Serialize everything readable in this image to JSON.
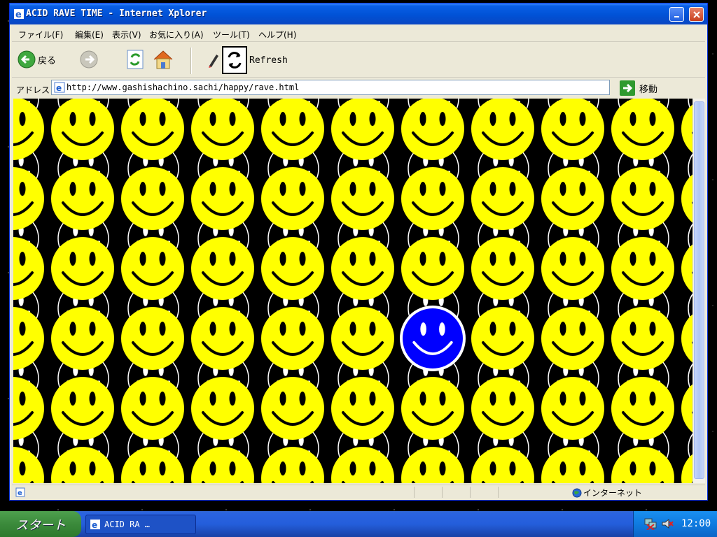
{
  "window": {
    "title": "ACID RAVE TIME - Internet Xplorer"
  },
  "menu": [
    "ファイル(F)",
    "編集(E)",
    "表示(V)",
    "お気に入り(A)",
    "ツール(T)",
    "ヘルプ(H)"
  ],
  "toolbar": {
    "back_label": "戻る",
    "refresh_label": "Refresh"
  },
  "address": {
    "label": "アドレス",
    "url": "http://www.gashishachino.sachi/happy/rave.html",
    "go_label": "移動"
  },
  "status": {
    "zone_label": "インターネット"
  },
  "taskbar": {
    "start_label": "スタート",
    "task_label": "ACID RA …",
    "clock": "12:00"
  },
  "colors": {
    "smiley_yellow": "#ffff00",
    "smiley_blue": "#0000ff",
    "content_bg": "#000000",
    "title_blue": "#0052d6"
  }
}
